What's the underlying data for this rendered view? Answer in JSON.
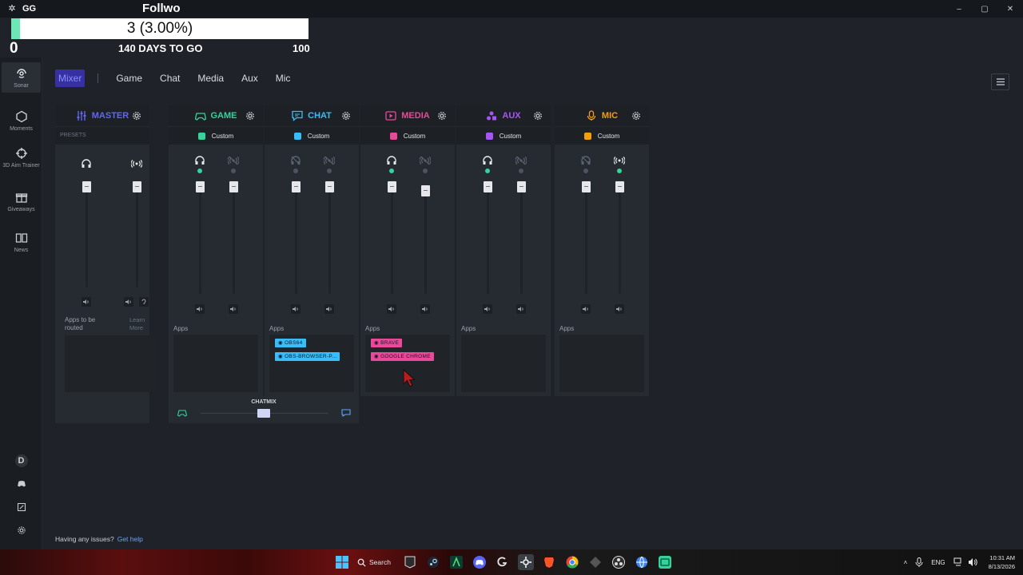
{
  "window": {
    "app_name": "GG",
    "controls": {
      "minimize": "–",
      "maximize": "▢",
      "close": "✕"
    }
  },
  "overlay": {
    "title": "Follwo",
    "goal_text": "3 (3.00%)",
    "progress_percent": 3,
    "start_value": "0",
    "days_left": "140 DAYS TO GO",
    "target": "100"
  },
  "sidebar": {
    "items": [
      {
        "label": "Sonar",
        "icon": "sonar-icon",
        "active": true
      },
      {
        "label": "Moments",
        "icon": "moments-icon"
      },
      {
        "label": "3D Aim Trainer",
        "icon": "aim-trainer-icon"
      },
      {
        "label": "Giveaways",
        "icon": "gift-icon"
      },
      {
        "label": "News",
        "icon": "news-icon"
      }
    ],
    "bottom": {
      "avatar_letter": "D"
    }
  },
  "tabs": [
    "Mixer",
    "Game",
    "Chat",
    "Media",
    "Aux",
    "Mic"
  ],
  "mixer": {
    "master": {
      "name": "MASTER",
      "color": "#6366f1",
      "presets_label": "PRESETS",
      "apps_label": "Apps to be routed",
      "learn_more": "Learn More"
    },
    "channels": [
      {
        "name": "GAME",
        "color": "#34d399",
        "preset": "Custom",
        "apps_label": "Apps",
        "apps": []
      },
      {
        "name": "CHAT",
        "color": "#38bdf8",
        "preset": "Custom",
        "apps_label": "Apps",
        "apps": [
          "OBS64",
          "OBS-BROWSER-P..."
        ]
      },
      {
        "name": "MEDIA",
        "color": "#ec4899",
        "preset": "Custom",
        "apps_label": "Apps",
        "apps": [
          "BRAVE",
          "GOOGLE CHROME"
        ]
      },
      {
        "name": "AUX",
        "color": "#a855f7",
        "preset": "Custom",
        "apps_label": "Apps",
        "apps": []
      },
      {
        "name": "MIC",
        "color": "#f59e0b",
        "preset": "Custom",
        "apps_label": "Apps",
        "apps": []
      }
    ],
    "chatmix": {
      "label": "CHATMIX"
    }
  },
  "footer": {
    "issues_text": "Having any issues?",
    "help_link": "Get help"
  },
  "taskbar": {
    "search_label": "Search",
    "language": "ENG",
    "time": "10:31 AM",
    "date": "8/13/2026"
  }
}
